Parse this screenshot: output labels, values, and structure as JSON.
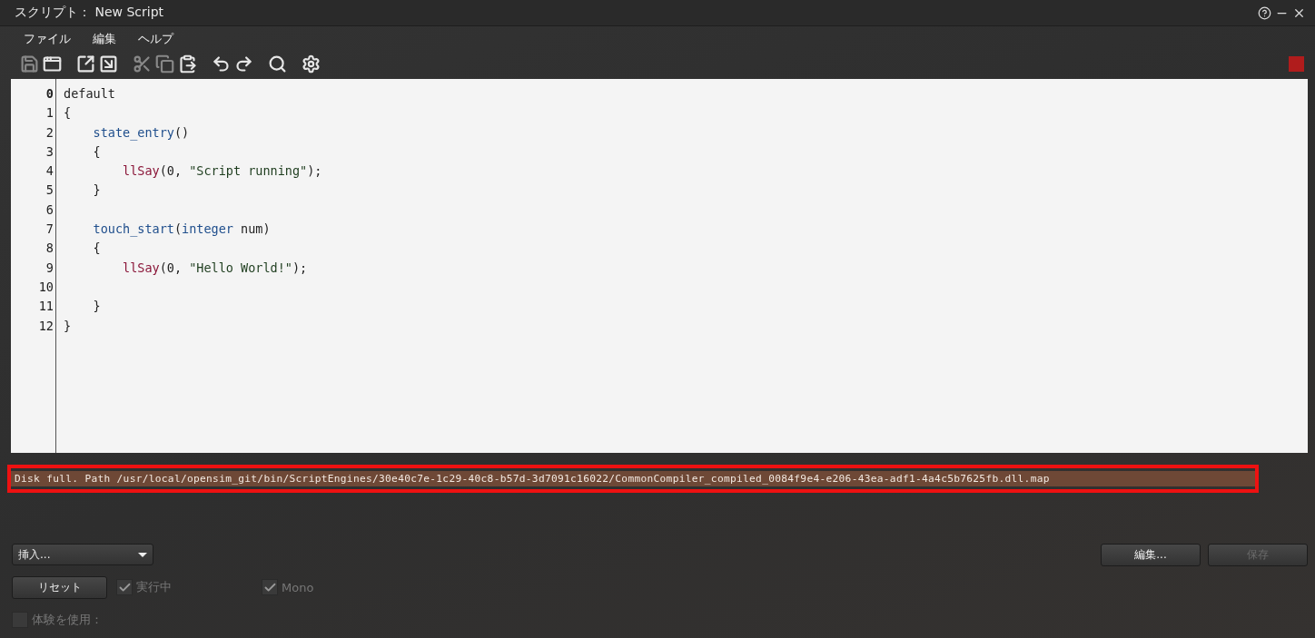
{
  "window": {
    "title": "スクリプト： New Script"
  },
  "menu": [
    {
      "label": "ファイル"
    },
    {
      "label": "編集"
    },
    {
      "label": "ヘルプ"
    }
  ],
  "toolbar": {
    "groups": [
      {
        "tools": [
          {
            "kind": "save",
            "disabled": true
          },
          {
            "kind": "window",
            "disabled": false
          }
        ]
      },
      {
        "tools": [
          {
            "kind": "export",
            "disabled": false
          },
          {
            "kind": "import",
            "disabled": false
          }
        ]
      },
      {
        "tools": [
          {
            "kind": "cut",
            "disabled": true
          },
          {
            "kind": "copy",
            "disabled": true
          },
          {
            "kind": "paste",
            "disabled": false
          }
        ]
      },
      {
        "tools": [
          {
            "kind": "undo",
            "disabled": false
          },
          {
            "kind": "redo",
            "disabled": false
          }
        ]
      },
      {
        "tools": [
          {
            "kind": "search",
            "disabled": false
          }
        ]
      },
      {
        "tools": [
          {
            "kind": "settings",
            "disabled": false
          }
        ]
      }
    ],
    "status_marker": {
      "color": "#b01c1c"
    }
  },
  "editor": {
    "lines": [
      {
        "number": "0",
        "current": true,
        "tokens": [
          {
            "kind": "plain",
            "text": "default"
          }
        ]
      },
      {
        "number": "1",
        "current": false,
        "tokens": [
          {
            "kind": "plain",
            "text": "{"
          }
        ]
      },
      {
        "number": "2",
        "current": false,
        "tokens": [
          {
            "kind": "event",
            "text": "    state_entry"
          },
          {
            "kind": "plain",
            "text": "()"
          }
        ]
      },
      {
        "number": "3",
        "current": false,
        "tokens": [
          {
            "kind": "plain",
            "text": "    {"
          }
        ]
      },
      {
        "number": "4",
        "current": false,
        "tokens": [
          {
            "kind": "function",
            "text": "        llSay"
          },
          {
            "kind": "plain",
            "text": "(0, "
          },
          {
            "kind": "string",
            "text": "\"Script running\""
          },
          {
            "kind": "plain",
            "text": ");"
          }
        ]
      },
      {
        "number": "5",
        "current": false,
        "tokens": [
          {
            "kind": "plain",
            "text": "    }"
          }
        ]
      },
      {
        "number": "6",
        "current": false
      },
      {
        "number": "7",
        "current": false,
        "tokens": [
          {
            "kind": "event",
            "text": "    touch_start"
          },
          {
            "kind": "plain",
            "text": "("
          },
          {
            "kind": "type",
            "text": "integer"
          },
          {
            "kind": "plain",
            "text": " num)"
          }
        ]
      },
      {
        "number": "8",
        "current": false,
        "tokens": [
          {
            "kind": "plain",
            "text": "    {"
          }
        ]
      },
      {
        "number": "9",
        "current": false,
        "tokens": [
          {
            "kind": "function",
            "text": "        llSay"
          },
          {
            "kind": "plain",
            "text": "(0, "
          },
          {
            "kind": "string",
            "text": "\"Hello World!\""
          },
          {
            "kind": "plain",
            "text": ");"
          }
        ]
      },
      {
        "number": "10",
        "current": false
      },
      {
        "number": "11",
        "current": false,
        "tokens": [
          {
            "kind": "plain",
            "text": "    }"
          }
        ]
      },
      {
        "number": "12",
        "current": false,
        "tokens": [
          {
            "kind": "plain",
            "text": "}"
          }
        ]
      }
    ]
  },
  "errors": [
    {
      "text": "Disk full. Path /usr/local/opensim_git/bin/ScriptEngines/30e40c7e-1c29-40c8-b57d-3d7091c16022/CommonCompiler_compiled_0084f9e4-e206-43ea-adf1-4a4c5b7625fb.dll.map",
      "selected": true
    }
  ],
  "insert_dropdown": {
    "value": "挿入..."
  },
  "buttons": [
    {
      "label": "編集...",
      "disabled": false
    },
    {
      "label": "保存",
      "disabled": true
    }
  ],
  "reset_button": {
    "label": "リセット"
  },
  "checkboxes": [
    {
      "label": "実行中",
      "checked": true,
      "disabled": true
    },
    {
      "label": "Mono",
      "checked": true,
      "disabled": true
    }
  ],
  "experience": {
    "label": "体験を使用：",
    "checked": false,
    "disabled": true
  }
}
